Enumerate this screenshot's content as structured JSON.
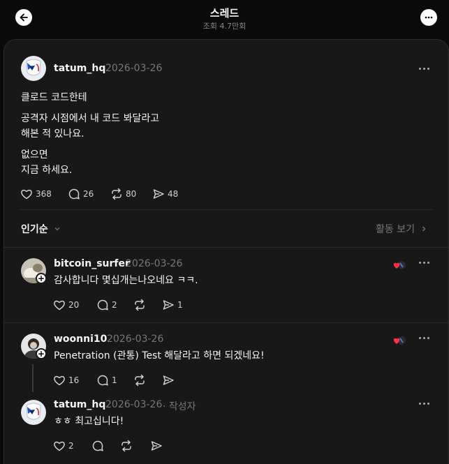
{
  "header": {
    "title": "스레드",
    "subtitle": "조회 4.7만회",
    "back_icon": "arrow-left-icon",
    "menu_icon": "more-horizontal-icon"
  },
  "post": {
    "username": "tatum_hq",
    "date": "2026-03-26",
    "paragraphs": [
      [
        "클로드 코드한테"
      ],
      [
        "공격자 시점에서 내 코드 봐달라고",
        "해본 적 있나요."
      ],
      [
        "없으면",
        "지금 하세요."
      ]
    ],
    "likes": "368",
    "comments": "26",
    "reposts": "80",
    "shares": "48"
  },
  "sort": {
    "label": "인기순",
    "activity_label": "활동 보기"
  },
  "replies": [
    {
      "username": "bitcoin_surfer",
      "date": "2026-03-26",
      "text": "감사합니다 몇십개는나오네요 ㅋㅋ.",
      "likes": "20",
      "comments": "2",
      "reposts": "",
      "shares": "1"
    },
    {
      "username": "woonni10",
      "date": "2026-03-26",
      "text": "Penetration (관통) Test 해달라고 하면 되겠네요!",
      "likes": "16",
      "comments": "1",
      "reposts": "",
      "shares": ""
    },
    {
      "username": "tatum_hq",
      "date": "2026-03-26",
      "author_tag": "· 작성자",
      "text": "ㅎㅎ 최고십니다!",
      "likes": "2",
      "comments": "",
      "reposts": "",
      "shares": ""
    }
  ],
  "colors": {
    "background": "#0a0a0a",
    "panel": "#181818",
    "text": "#f3f5f7",
    "muted": "#777777",
    "border": "#2d2d2d",
    "badge_heart": "#ff3040"
  }
}
